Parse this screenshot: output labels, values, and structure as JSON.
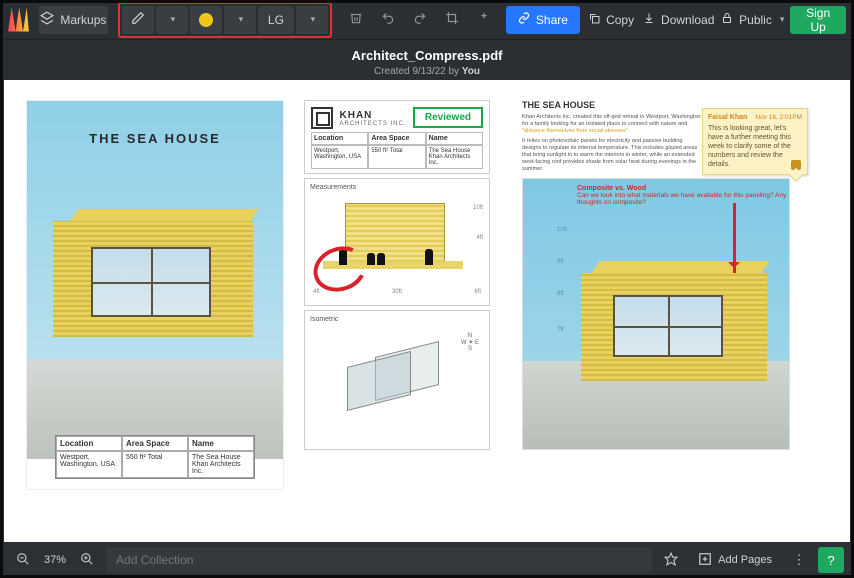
{
  "toolbar": {
    "markups_label": "Markups",
    "size_label": "LG",
    "share_label": "Share",
    "copy_label": "Copy",
    "download_label": "Download",
    "public_label": "Public",
    "signup_label": "Sign Up"
  },
  "title": {
    "filename": "Architect_Compress.pdf",
    "created_prefix": "Created 9/13/22 by ",
    "created_by": "You"
  },
  "doc": {
    "project_title": "THE SEA HOUSE",
    "firm": {
      "name": "KHAN",
      "sub": "ARCHITECTS INC."
    },
    "reviewed_stamp": "Reviewed",
    "info_headers": {
      "location": "Location",
      "area": "Area Space",
      "name": "Name"
    },
    "info_values": {
      "location": "Westport,\nWashington, USA",
      "area": "550 ft²\nTotal",
      "name": "The Sea House\nKhan Architects Inc."
    },
    "measurements_label": "Measurements",
    "isometric_label": "Isometric",
    "dimensions": {
      "width": "30ft",
      "height_top": "10ft",
      "height_mid": "4ft",
      "left": "4ft",
      "right": "6ft"
    },
    "compass": {
      "n": "N",
      "s": "S",
      "e": "E",
      "w": "W"
    },
    "p3": {
      "heading": "THE SEA HOUSE",
      "para1": "Khan Architects Inc. created this off-grid retreat in Westport, Washington for a family looking for an isolated place to connect with nature and ",
      "para1_hl": "\"distance themselves from social stresses\".",
      "para2": "It relies on photovoltaic panels for electricity and passive building designs to regulate its internal temperature. This includes glazed areas that bring sunlight in to warm the interiors in winter, while an extended west-facing roof provides shade from solar heat during evenings in the summer."
    },
    "axis_labels": {
      "y1": "10ft",
      "y2": "9ft",
      "y3": "8ft",
      "y4": "7ft"
    },
    "annotation": {
      "title": "Composite vs. Wood",
      "body": "Can we look into what materials we have available for this paneling? Any thoughts on composite?"
    }
  },
  "comment": {
    "author": "Faisal Khan",
    "timestamp": "Nov 16, 2:01PM",
    "body": "This is looking great, let's have a further meeting this week to clarify some of the numbers and review the details."
  },
  "bottombar": {
    "zoom_pct": "37%",
    "collection_placeholder": "Add Collection",
    "add_pages_label": "Add Pages"
  }
}
